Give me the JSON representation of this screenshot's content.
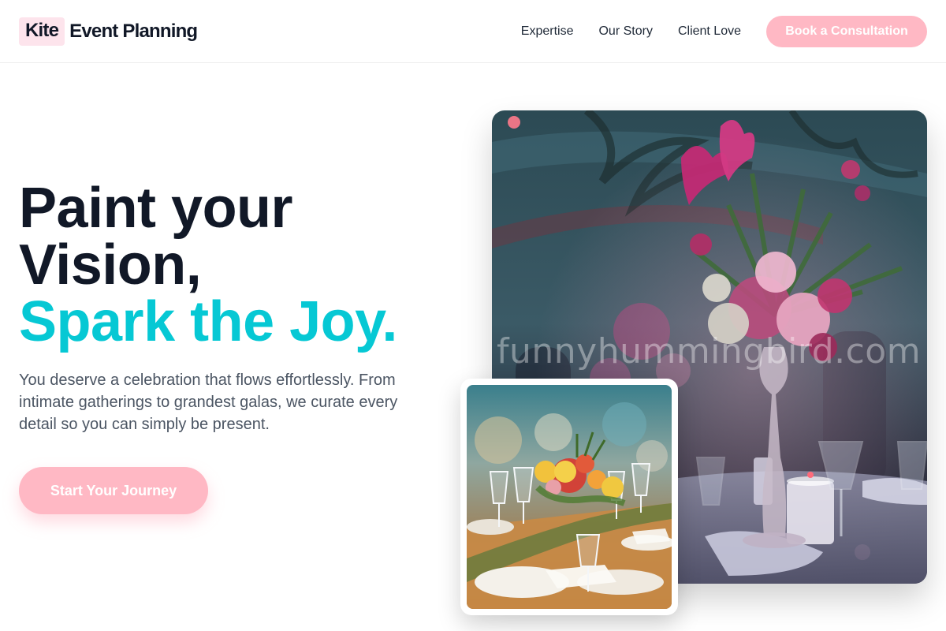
{
  "header": {
    "logo_mark": "Kite",
    "logo_text": "Event Planning",
    "nav": [
      {
        "label": "Expertise"
      },
      {
        "label": "Our Story"
      },
      {
        "label": "Client Love"
      }
    ],
    "cta_label": "Book a Consultation"
  },
  "hero": {
    "title_line1": "Paint your",
    "title_line2": "Vision,",
    "title_accent": "Spark the Joy.",
    "description": "You deserve a celebration that flows effortlessly. From intimate gatherings to grandest galas, we curate every detail so you can simply be present.",
    "button_label": "Start Your Journey"
  },
  "images": {
    "main_alt": "Floral centerpiece on elegant banquet table",
    "small_alt": "Long dining table with colorful flower arrangement",
    "watermark": "funnyhummingbird.com"
  },
  "colors": {
    "accent_teal": "#06c8d4",
    "button_pink": "#ffb8c4",
    "logo_mark_bg": "#fde4ec",
    "heading": "#111827",
    "body_text": "#4b5563"
  }
}
